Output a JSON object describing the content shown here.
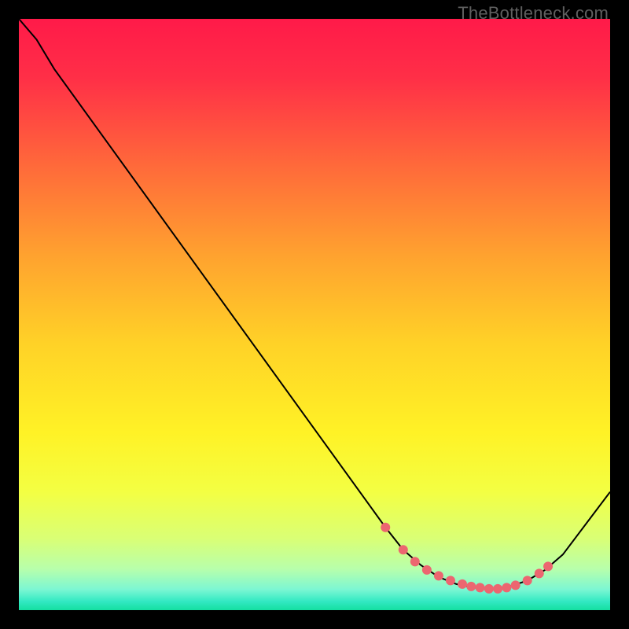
{
  "watermark": "TheBottleneck.com",
  "chart_data": {
    "type": "line",
    "title": "",
    "xlabel": "",
    "ylabel": "",
    "xlim": [
      0,
      100
    ],
    "ylim": [
      0,
      100
    ],
    "gradient_stops": [
      {
        "offset": 0.0,
        "color": "#ff1a49"
      },
      {
        "offset": 0.1,
        "color": "#ff2f47"
      },
      {
        "offset": 0.25,
        "color": "#ff6a3a"
      },
      {
        "offset": 0.4,
        "color": "#ffa22f"
      },
      {
        "offset": 0.55,
        "color": "#ffd227"
      },
      {
        "offset": 0.7,
        "color": "#fff226"
      },
      {
        "offset": 0.8,
        "color": "#f3ff43"
      },
      {
        "offset": 0.88,
        "color": "#d9ff76"
      },
      {
        "offset": 0.93,
        "color": "#b8ffab"
      },
      {
        "offset": 0.965,
        "color": "#7cf7d3"
      },
      {
        "offset": 0.985,
        "color": "#33e9c3"
      },
      {
        "offset": 1.0,
        "color": "#14dfa0"
      }
    ],
    "curve": [
      {
        "x": 0.0,
        "y": 100.0
      },
      {
        "x": 3.0,
        "y": 96.5
      },
      {
        "x": 6.0,
        "y": 91.5
      },
      {
        "x": 62.0,
        "y": 14.0
      },
      {
        "x": 65.0,
        "y": 10.2
      },
      {
        "x": 68.0,
        "y": 7.6
      },
      {
        "x": 71.0,
        "y": 5.6
      },
      {
        "x": 74.0,
        "y": 4.4
      },
      {
        "x": 77.0,
        "y": 3.8
      },
      {
        "x": 80.0,
        "y": 3.6
      },
      {
        "x": 83.0,
        "y": 4.0
      },
      {
        "x": 86.0,
        "y": 5.0
      },
      {
        "x": 89.0,
        "y": 6.8
      },
      {
        "x": 92.0,
        "y": 9.4
      },
      {
        "x": 100.0,
        "y": 20.0
      }
    ],
    "markers": [
      {
        "x": 62.0,
        "y": 14.0
      },
      {
        "x": 65.0,
        "y": 10.2
      },
      {
        "x": 67.0,
        "y": 8.2
      },
      {
        "x": 69.0,
        "y": 6.8
      },
      {
        "x": 71.0,
        "y": 5.8
      },
      {
        "x": 73.0,
        "y": 5.0
      },
      {
        "x": 75.0,
        "y": 4.4
      },
      {
        "x": 76.5,
        "y": 4.0
      },
      {
        "x": 78.0,
        "y": 3.8
      },
      {
        "x": 79.5,
        "y": 3.6
      },
      {
        "x": 81.0,
        "y": 3.6
      },
      {
        "x": 82.5,
        "y": 3.8
      },
      {
        "x": 84.0,
        "y": 4.2
      },
      {
        "x": 86.0,
        "y": 5.0
      },
      {
        "x": 88.0,
        "y": 6.2
      },
      {
        "x": 89.5,
        "y": 7.4
      }
    ],
    "marker_color": "#ec6670",
    "curve_color": "#000000"
  }
}
